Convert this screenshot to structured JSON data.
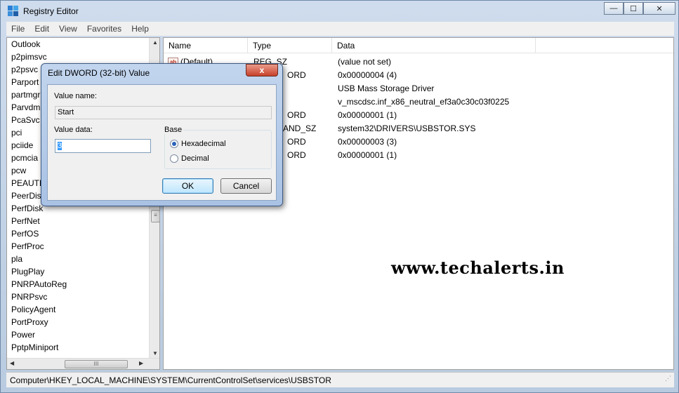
{
  "window": {
    "title": "Registry Editor",
    "controls": {
      "minimize": "—",
      "maximize": "☐",
      "close": "✕"
    }
  },
  "menu": [
    "File",
    "Edit",
    "View",
    "Favorites",
    "Help"
  ],
  "tree": {
    "items": [
      "Outlook",
      "p2pimsvc",
      "p2psvc",
      "Parport",
      "partmgr",
      "Parvdm",
      "PcaSvc",
      "pci",
      "pciide",
      "pcmcia",
      "pcw",
      "PEAUTH",
      "PeerDistSvc",
      "PerfDisk",
      "PerfNet",
      "PerfOS",
      "PerfProc",
      "pla",
      "PlugPlay",
      "PNRPAutoReg",
      "PNRPsvc",
      "PolicyAgent",
      "PortProxy",
      "Power",
      "PptpMiniport"
    ],
    "scroll_thumb_glyph": "III"
  },
  "list": {
    "columns": [
      "Name",
      "Type",
      "Data"
    ],
    "rows": [
      {
        "name": "(Default)",
        "type": "REG_SZ",
        "data": "(value not set)"
      },
      {
        "name": "",
        "type": "ORD",
        "data": "0x00000004 (4)"
      },
      {
        "name": "",
        "type": "",
        "data": "USB Mass Storage Driver"
      },
      {
        "name": "",
        "type": "",
        "data": "v_mscdsc.inf_x86_neutral_ef3a0c30c03f0225"
      },
      {
        "name": "",
        "type": "ORD",
        "data": "0x00000001 (1)"
      },
      {
        "name": "",
        "type": "AND_SZ",
        "data": "system32\\DRIVERS\\USBSTOR.SYS"
      },
      {
        "name": "",
        "type": "ORD",
        "data": "0x00000003 (3)"
      },
      {
        "name": "",
        "type": "ORD",
        "data": "0x00000001 (1)"
      }
    ]
  },
  "watermark": "www.techalerts.in",
  "statusbar": {
    "path": "Computer\\HKEY_LOCAL_MACHINE\\SYSTEM\\CurrentControlSet\\services\\USBSTOR"
  },
  "dialog": {
    "title": "Edit DWORD (32-bit) Value",
    "close_glyph": "x",
    "value_name_label": "Value name:",
    "value_name": "Start",
    "value_data_label": "Value data:",
    "value_data": "3",
    "base_label": "Base",
    "radio_hex": "Hexadecimal",
    "radio_dec": "Decimal",
    "selected_base": "Hexadecimal",
    "ok": "OK",
    "cancel": "Cancel"
  },
  "colors": {
    "selection": "#3399ff",
    "close_button": "#c8412b"
  }
}
